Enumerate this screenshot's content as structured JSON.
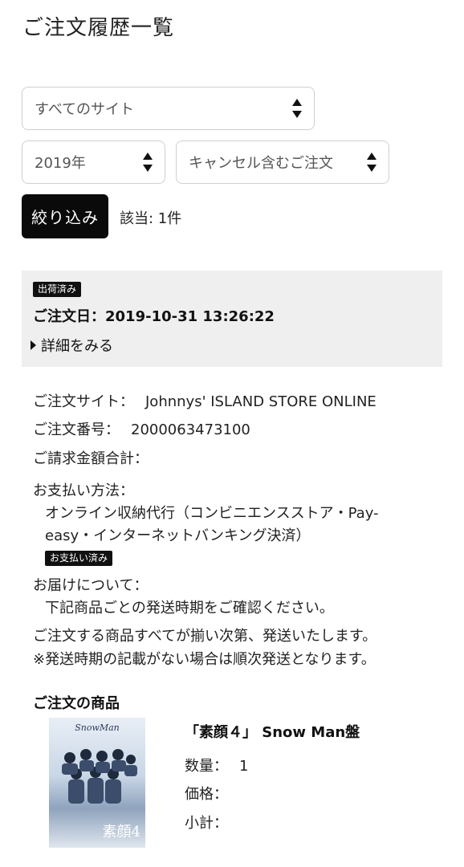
{
  "page": {
    "title": "ご注文履歴一覧"
  },
  "filters": {
    "site": "すべてのサイト",
    "year": "2019年",
    "status": "キャンセル含むご注文",
    "submit_label": "絞り込み",
    "result_count": "該当: 1件"
  },
  "order": {
    "status_badge": "出荷済み",
    "date": "ご注文日：2019-10-31 13:26:22",
    "details_link": "詳細をみる",
    "site_label": "ご注文サイト：",
    "site_value": "Johnnys' ISLAND STORE ONLINE",
    "number_label": "ご注文番号：",
    "number_value": "2000063473100",
    "total_label": "ご請求金額合計：",
    "payment_label": "お支払い方法：",
    "payment_line1": "オンライン収納代行（コンビニエンスストア・Pay-",
    "payment_line2": "easy・インターネットバンキング決済）",
    "payment_badge": "お支払い済み",
    "delivery_label": "お届けについて：",
    "delivery_line1": "下記商品ごとの発送時期をご確認ください。",
    "delivery_line2": "ご注文する商品すべてが揃い次第、発送いたします。",
    "delivery_line3": "※発送時期の記載がない場合は順次発送となります。"
  },
  "products": {
    "section_title": "ご注文の商品",
    "items": [
      {
        "image_logo": "SnowMan",
        "image_text": "素顔4",
        "title": "「素顔４」 Snow Man盤",
        "quantity_label": "数量：",
        "quantity_value": "1",
        "price_label": "価格：",
        "subtotal_label": "小計："
      }
    ]
  }
}
